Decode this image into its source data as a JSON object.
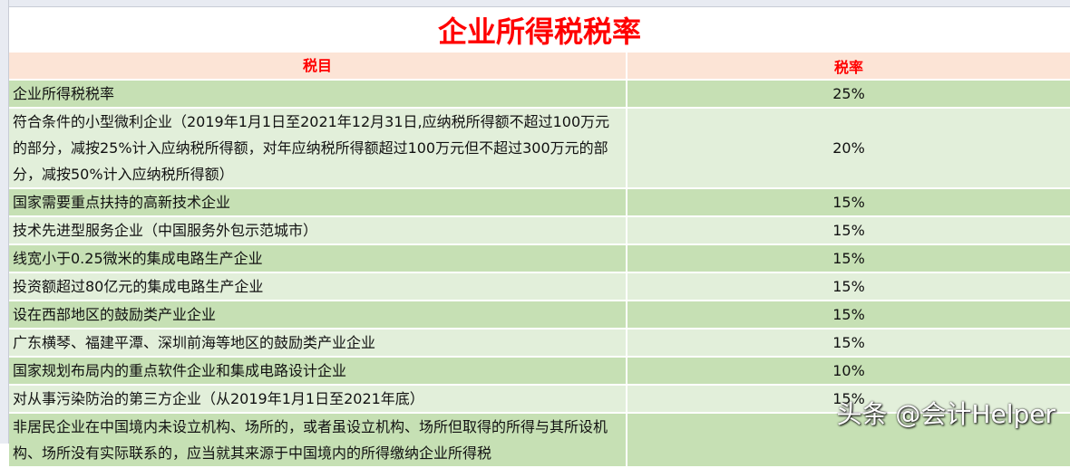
{
  "title": "企业所得税税率",
  "headers": {
    "item": "税目",
    "rate": "税率"
  },
  "rows": [
    {
      "item": "企业所得税税率",
      "rate": "25%"
    },
    {
      "item": "符合条件的小型微利企业（2019年1月1日至2021年12月31日,应纳税所得额不超过100万元的部分，减按25%计入应纳税所得额，对年应纳税所得额超过100万元但不超过300万元的部分，减按50%计入应纳税所得额）",
      "rate": "20%"
    },
    {
      "item": "国家需要重点扶持的高新技术企业",
      "rate": "15%"
    },
    {
      "item": "技术先进型服务企业（中国服务外包示范城市）",
      "rate": "15%"
    },
    {
      "item": "线宽小于0.25微米的集成电路生产企业",
      "rate": "15%"
    },
    {
      "item": "投资额超过80亿元的集成电路生产企业",
      "rate": "15%"
    },
    {
      "item": "设在西部地区的鼓励类产业企业",
      "rate": "15%"
    },
    {
      "item": "广东横琴、福建平潭、深圳前海等地区的鼓励类产业企业",
      "rate": "15%"
    },
    {
      "item": "国家规划布局内的重点软件企业和集成电路设计企业",
      "rate": "10%"
    },
    {
      "item": "对从事污染防治的第三方企业（从2019年1月1日至2021年底）",
      "rate": "15%"
    },
    {
      "item": "非居民企业在中国境内未设立机构、场所的，或者虽设立机构、场所但取得的所得与其所设机构、场所没有实际联系的，应当就其来源于中国境内的所得缴纳企业所得税",
      "rate": ""
    }
  ],
  "watermark": "头条 @会计Helper"
}
